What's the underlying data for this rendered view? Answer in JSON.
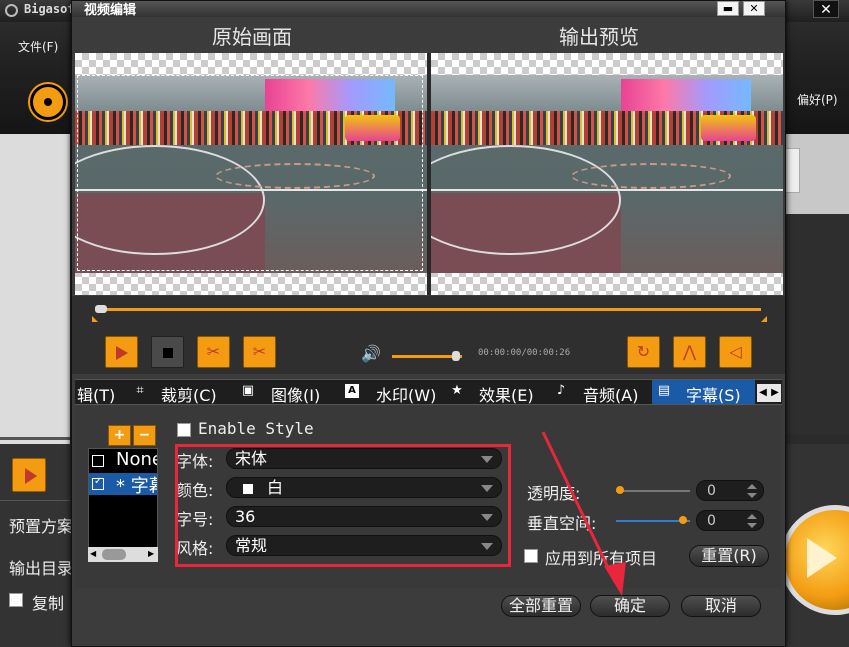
{
  "background": {
    "app_name": "Bigasoft",
    "menu_file": "文件(F)",
    "prefs": "偏好(P)",
    "preset_label": "预置方案",
    "output_label": "输出目录",
    "copy_label": "复制",
    "close_glyph": "✕"
  },
  "dialog": {
    "title": "视频编辑",
    "min_glyph": "▬",
    "close_glyph": "✕",
    "original_title": "原始画面",
    "preview_title": "输出预览",
    "timecode": "00:00:00/00:00:26",
    "volume_fraction": 0.92,
    "timeline_position": 0.0,
    "tabs": [
      {
        "label": "辑(T)",
        "icon": ""
      },
      {
        "label": "裁剪(C)",
        "icon": "crop-icon"
      },
      {
        "label": "图像(I)",
        "icon": "image-icon"
      },
      {
        "label": "水印(W)",
        "icon": "watermark-icon"
      },
      {
        "label": "效果(E)",
        "icon": "star-icon"
      },
      {
        "label": "音频(A)",
        "icon": "music-icon"
      },
      {
        "label": "字幕(S)",
        "icon": "subtitle-icon"
      }
    ],
    "active_tab": "字幕(S)",
    "subtitle": {
      "add_label": "+",
      "remove_label": "−",
      "list_items": [
        {
          "label": "None",
          "checked": false,
          "selected": false
        },
        {
          "label": "* 字幕",
          "checked": true,
          "selected": true
        }
      ],
      "enable_style_label": "Enable Style",
      "font_label": "字体:",
      "font_value": "宋体",
      "color_label": "颜色:",
      "color_value": "白",
      "size_label": "字号:",
      "size_value": "36",
      "style_label": "风格:",
      "style_value": "常规",
      "opacity_label": "透明度:",
      "opacity_value": "0",
      "vspace_label": "垂直空间:",
      "vspace_value": "0",
      "vspace_fraction": 0.9,
      "opacity_fraction": 0.0,
      "apply_all_label": "应用到所有项目",
      "reset_label": "重置(R)"
    },
    "reset_all_label": "全部重置",
    "ok_label": "确定",
    "cancel_label": "取消"
  },
  "colors": {
    "accent": "#f39c12",
    "selection": "#1a5aa6",
    "highlight_box": "#e8263c"
  }
}
